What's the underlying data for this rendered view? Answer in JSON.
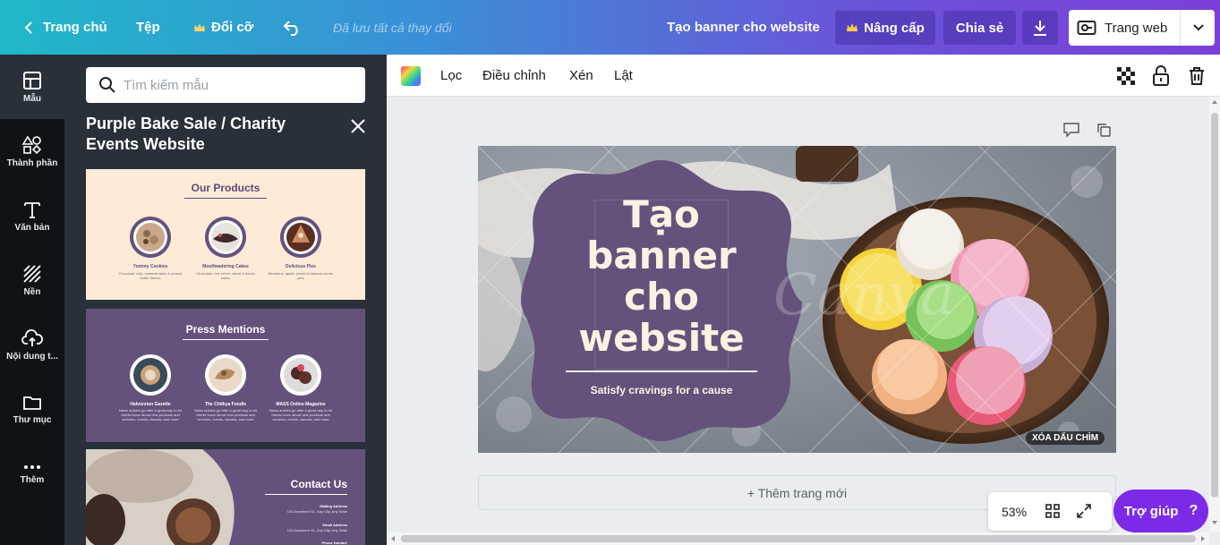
{
  "topbar": {
    "home": "Trang chủ",
    "file": "Tệp",
    "resize": "Đổi cỡ",
    "undo_icon": "undo-icon",
    "saved_status": "Đã lưu tất cả thay đổi",
    "doc_title": "Tạo banner cho website",
    "upgrade": "Nâng cấp",
    "share": "Chia sẻ",
    "download_icon": "download-icon",
    "publish": "Trang web"
  },
  "rail": {
    "items": [
      {
        "label": "Mẫu",
        "icon": "template-icon"
      },
      {
        "label": "Thành phần",
        "icon": "elements-icon"
      },
      {
        "label": "Văn bản",
        "icon": "text-icon"
      },
      {
        "label": "Nền",
        "icon": "background-icon"
      },
      {
        "label": "Nội dung t...",
        "icon": "upload-icon"
      },
      {
        "label": "Thư mục",
        "icon": "folder-icon"
      },
      {
        "label": "Thêm",
        "icon": "more-icon"
      }
    ]
  },
  "panel": {
    "search_placeholder": "Tìm kiếm mẫu",
    "title": "Purple Bake Sale / Charity Events Website",
    "templates": {
      "products": {
        "heading": "Our Products",
        "items": [
          {
            "name": "Yummy Cookies",
            "desc": "Chocolate chip, oatmeal raisin & peanut butter flavors"
          },
          {
            "name": "Mouthwatering Cakes",
            "desc": "Chocolate, red velvet, carrot & lemon cakes"
          },
          {
            "name": "Delicious Pies",
            "desc": "Blueberry, apple, peach & banana creme pies"
          }
        ]
      },
      "press": {
        "heading": "Press Mentions",
        "items": [
          {
            "name": "Halvorsion Gazette",
            "desc": "News articles go after a great way to let clients know about new products and services, events, awards, and more"
          },
          {
            "name": "The Chitkya Foodle",
            "desc": "News articles go after a great way to let clients know about new products and services, events, awards, and more"
          },
          {
            "name": "MASS Online Magazine",
            "desc": "News articles go after a great way to let clients know about new products and services, events, awards, and more"
          }
        ]
      },
      "contact": {
        "heading": "Contact Us",
        "mailing_label": "Mailing Address",
        "mailing_value": "123 Anywhere St., Any City, Any State",
        "email_label": "Email Address",
        "email_value": "123 Anywhere St., Any City, Any State",
        "phone_label": "Phone Number"
      }
    }
  },
  "edit_toolbar": {
    "filter": "Lọc",
    "adjust": "Điều chỉnh",
    "crop": "Xén",
    "flip": "Lật"
  },
  "design": {
    "headline": [
      "Tạo",
      "banner",
      "cho",
      "website"
    ],
    "subtitle": "Satisfy cravings for a cause",
    "watermark": "Canva",
    "remove_watermark": "XÓA DẤU CHÌM"
  },
  "canvas": {
    "add_page": "+ Thêm trang mới",
    "zoom": "53%"
  },
  "help": {
    "label": "Trợ giúp",
    "mark": "?"
  },
  "colors": {
    "accent": "#7d2ae8",
    "purple_brand": "#64527c",
    "panel_bg": "#293039",
    "rail_bg": "#0e1318"
  }
}
